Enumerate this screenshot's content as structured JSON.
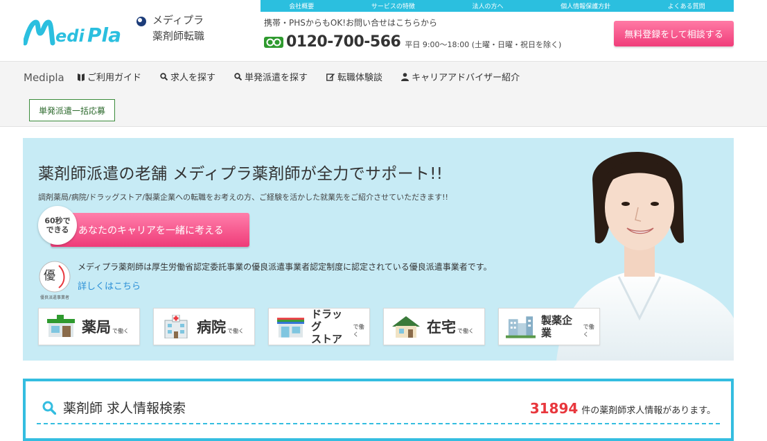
{
  "brand": {
    "logo_text": "Medi Pla",
    "name_line1": "メディプラ",
    "name_line2": "薬剤師転職",
    "colors": {
      "primary": "#2bbfdf",
      "accent_pink": "#f03d7a",
      "count_red": "#e8373d"
    }
  },
  "topnav": [
    "会社概要",
    "サービスの特徴",
    "法人の方へ",
    "個人情報保護方針",
    "よくある質問"
  ],
  "contact": {
    "note": "携帯・PHSからもOK!お問い合せはこちらから",
    "phone": "0120-700-566",
    "hours": "平日 9:00～18:00 (土曜・日曜・祝日を除く)",
    "freedial_icon": "freedial-icon"
  },
  "register_button": "無料登録をして相談する",
  "mainnav": {
    "brand": "Medipla",
    "items": [
      {
        "label": "ご利用ガイド",
        "icon": "book-icon"
      },
      {
        "label": "求人を探す",
        "icon": "search-icon"
      },
      {
        "label": "単発派遣を探す",
        "icon": "search-icon"
      },
      {
        "label": "転職体験談",
        "icon": "edit-icon"
      },
      {
        "label": "キャリアアドバイザー紹介",
        "icon": "person-icon"
      }
    ],
    "bulk_button": "単発派遣一括応募"
  },
  "hero": {
    "title": "薬剤師派遣の老舗 メディプラ薬剤師が全力でサポート!!",
    "subtitle": "調剤薬局/病院/ドラッグストア/製薬企業への転職をお考えの方、ご経験を活かした就業先をご紹介させていただきます!!",
    "badge_line1": "60秒で",
    "badge_line2": "できる",
    "cta": "あなたのキャリアを一緒に考える",
    "cert_logo_char": "優",
    "cert_logo_caption": "優良派遣事業者",
    "cert_text": "メディプラ薬剤師は厚生労働省認定委託事業の優良派遣事業者認定制度に認定されている優良派遣事業者です。",
    "cert_link": "詳しくはこちら",
    "categories": [
      {
        "label": "薬局",
        "suffix": "で働く",
        "icon": "pharmacy-icon"
      },
      {
        "label": "病院",
        "suffix": "で働く",
        "icon": "hospital-icon"
      },
      {
        "label_line1": "ドラッグ",
        "label_line2": "ストア",
        "suffix": "で働く",
        "icon": "drugstore-icon"
      },
      {
        "label": "在宅",
        "suffix": "で働く",
        "icon": "home-icon"
      },
      {
        "label": "製薬企業",
        "suffix": "で働く",
        "icon": "factory-icon"
      }
    ]
  },
  "search": {
    "title": "薬剤師 求人情報検索",
    "count": "31894",
    "count_text": "件の薬剤師求人情報があります。"
  }
}
